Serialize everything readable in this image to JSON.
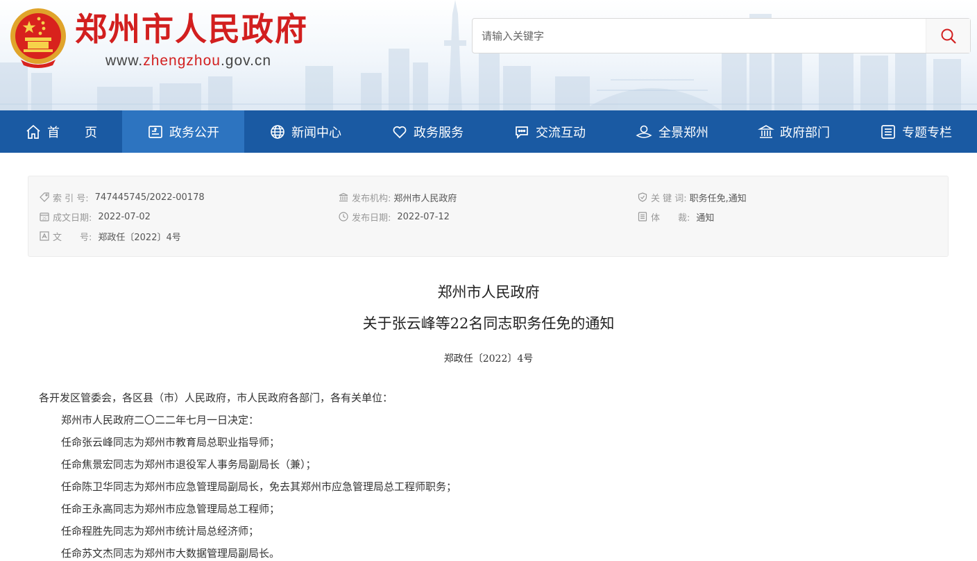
{
  "header": {
    "site_title": "郑州市人民政府",
    "url_prefix": "www.",
    "url_highlight": "zhengzhou",
    "url_suffix": ".gov.cn",
    "brand_red": "#d21f1f"
  },
  "search": {
    "placeholder": "请输入关键字",
    "button_icon": "search-icon"
  },
  "nav": {
    "color": "#1a5aa3",
    "active_color": "#2d74c0",
    "items": [
      {
        "label": "首　　页",
        "icon": "home-icon"
      },
      {
        "label": "政务公开",
        "icon": "document-icon",
        "active": true
      },
      {
        "label": "新闻中心",
        "icon": "globe-icon"
      },
      {
        "label": "政务服务",
        "icon": "heart-icon"
      },
      {
        "label": "交流互动",
        "icon": "chat-icon"
      },
      {
        "label": "全景郑州",
        "icon": "panorama-icon"
      },
      {
        "label": "政府部门",
        "icon": "building-icon"
      },
      {
        "label": "专题专栏",
        "icon": "list-icon"
      }
    ]
  },
  "meta": {
    "index_label": "索 引 号:",
    "index_value": "747445745/2022-00178",
    "org_label": "发布机构:",
    "org_value": "郑州市人民政府",
    "keywords_label": "关 键 词:",
    "keywords_value": "职务任免,通知",
    "created_label": "成文日期:",
    "created_value": "2022-07-02",
    "published_label": "发布日期:",
    "published_value": "2022-07-12",
    "genre_label": "体　　裁:",
    "genre_value": "通知",
    "docno_label": "文　　号:",
    "docno_value": "郑政任〔2022〕4号"
  },
  "document": {
    "title_line1": "郑州市人民政府",
    "title_line2": "关于张云峰等22名同志职务任免的通知",
    "doc_number": "郑政任〔2022〕4号",
    "salutation": "各开发区管委会，各区县（市）人民政府，市人民政府各部门，各有关单位：",
    "paragraphs": [
      "郑州市人民政府二〇二二年七月一日决定：",
      "任命张云峰同志为郑州市教育局总职业指导师；",
      "任命焦景宏同志为郑州市退役军人事务局副局长（兼）；",
      "任命陈卫华同志为郑州市应急管理局副局长，免去其郑州市应急管理局总工程师职务；",
      "任命王永高同志为郑州市应急管理局总工程师；",
      "任命程胜先同志为郑州市统计局总经济师；",
      "任命苏文杰同志为郑州市大数据管理局副局长。"
    ]
  }
}
